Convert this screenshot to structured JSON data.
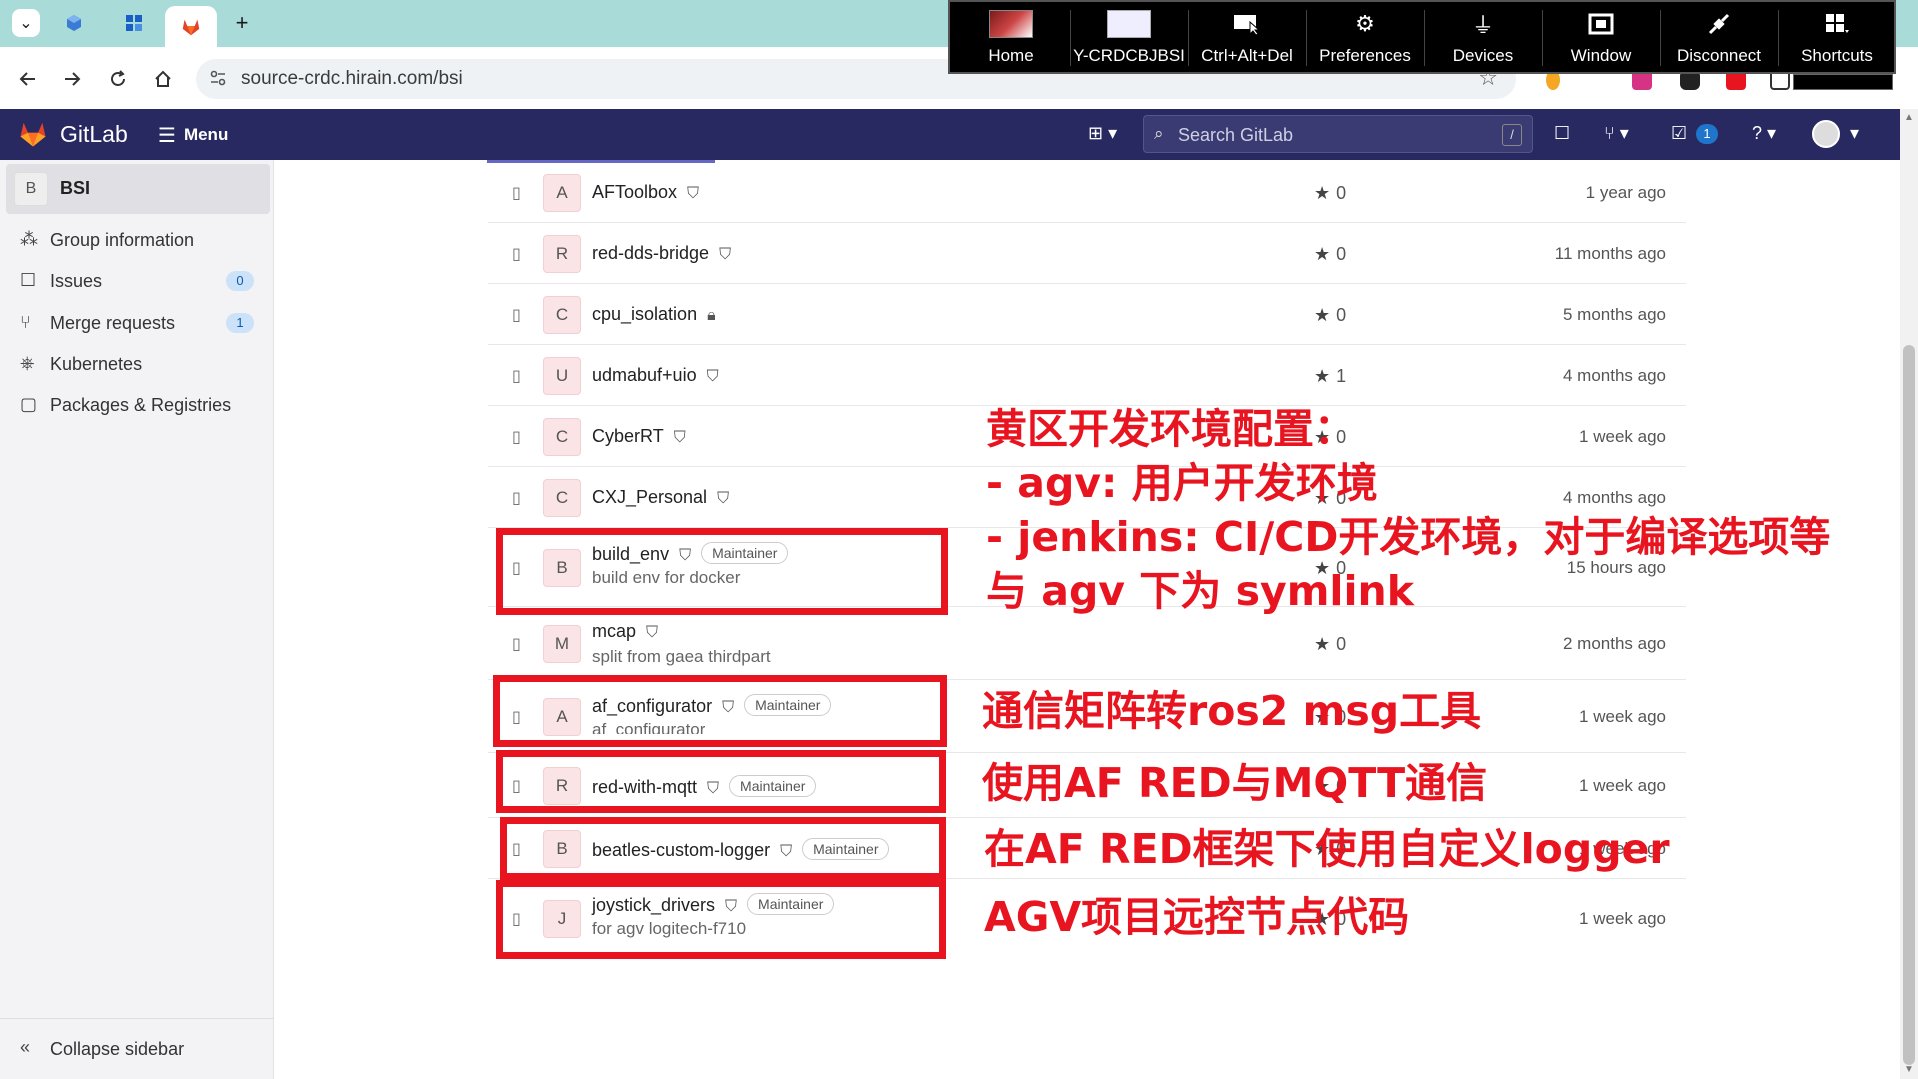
{
  "browser": {
    "url": "source-crdc.hirain.com/bsi",
    "new_tab": "+",
    "tab_menu": "⌄"
  },
  "rdp_toolbar": {
    "items": [
      {
        "label": "Home",
        "icon": "home-thumbnail-icon"
      },
      {
        "label": "Y-CRDCBJBSI",
        "icon": "machine-thumbnail-icon"
      },
      {
        "label": "Ctrl+Alt+Del",
        "icon": "ctrl-alt-del-icon"
      },
      {
        "label": "Preferences",
        "icon": "gears-icon"
      },
      {
        "label": "Devices",
        "icon": "usb-icon"
      },
      {
        "label": "Window",
        "icon": "window-icon"
      },
      {
        "label": "Disconnect",
        "icon": "plug-icon"
      },
      {
        "label": "Shortcuts",
        "icon": "grid-icon"
      }
    ]
  },
  "gitlab": {
    "title": "GitLab",
    "menu_label": "Menu",
    "search_placeholder": "Search GitLab",
    "search_shortcut": "/",
    "todo_count": "1"
  },
  "sidebar": {
    "group_avatar": "B",
    "group_name": "BSI",
    "items": [
      {
        "label": "Group information",
        "icon": "group-info-icon",
        "glyph": "⁂"
      },
      {
        "label": "Issues",
        "icon": "issues-icon",
        "glyph": "☐",
        "count": "0"
      },
      {
        "label": "Merge requests",
        "icon": "merge-request-icon",
        "glyph": "⑂",
        "count": "1"
      },
      {
        "label": "Kubernetes",
        "icon": "kubernetes-icon",
        "glyph": "⎈"
      },
      {
        "label": "Packages & Registries",
        "icon": "package-icon",
        "glyph": "▢"
      }
    ],
    "collapse_label": "Collapse sidebar"
  },
  "projects": [
    {
      "avatar": "A",
      "name": "AFToolbox",
      "visibility": "shield",
      "role": "",
      "description": "",
      "stars": "0",
      "updated": "1 year ago"
    },
    {
      "avatar": "R",
      "name": "red-dds-bridge",
      "visibility": "shield",
      "role": "",
      "description": "",
      "stars": "0",
      "updated": "11 months ago"
    },
    {
      "avatar": "C",
      "name": "cpu_isolation",
      "visibility": "lock",
      "role": "",
      "description": "",
      "stars": "0",
      "updated": "5 months ago"
    },
    {
      "avatar": "U",
      "name": "udmabuf+uio",
      "visibility": "shield",
      "role": "",
      "description": "",
      "stars": "1",
      "updated": "4 months ago"
    },
    {
      "avatar": "C",
      "name": "CyberRT",
      "visibility": "shield",
      "role": "",
      "description": "",
      "stars": "0",
      "updated": "1 week ago"
    },
    {
      "avatar": "C",
      "name": "CXJ_Personal",
      "visibility": "shield",
      "role": "",
      "description": "",
      "stars": "0",
      "updated": "4 months ago"
    },
    {
      "avatar": "B",
      "name": "build_env",
      "visibility": "shield",
      "role": "Maintainer",
      "description": "build env for docker",
      "stars": "0",
      "updated": "15 hours ago"
    },
    {
      "avatar": "M",
      "name": "mcap",
      "visibility": "shield",
      "role": "",
      "description": "split from gaea thirdpart",
      "stars": "0",
      "updated": "2 months ago"
    },
    {
      "avatar": "A",
      "name": "af_configurator",
      "visibility": "shield",
      "role": "Maintainer",
      "description": "af_configurator",
      "stars": "0",
      "updated": "1 week ago"
    },
    {
      "avatar": "R",
      "name": "red-with-mqtt",
      "visibility": "shield",
      "role": "Maintainer",
      "description": "",
      "stars": "0",
      "updated": "1 week ago"
    },
    {
      "avatar": "B",
      "name": "beatles-custom-logger",
      "visibility": "shield",
      "role": "Maintainer",
      "description": "",
      "stars": "0",
      "updated": "1 week ago"
    },
    {
      "avatar": "J",
      "name": "joystick_drivers",
      "visibility": "shield",
      "role": "Maintainer",
      "description": "for agv logitech-f710",
      "stars": "0",
      "updated": "1 week ago"
    }
  ],
  "annotations": {
    "build_env_lines": [
      "黄区开发环境配置：",
      "- agv: 用户开发环境",
      "- jenkins: CI/CD开发环境，对于编译选项等",
      "与 agv 下为 symlink"
    ],
    "af_configurator": "通信矩阵转ros2 msg工具",
    "red_with_mqtt": "使用AF RED与MQTT通信",
    "beatles_custom_logger": "在AF RED框架下使用自定义logger",
    "joystick_drivers": "AGV项目远控节点代码"
  },
  "colors": {
    "tab_strip": "#a9dcd8",
    "gitlab_nav": "#292961",
    "annotation_red": "#e8141f",
    "avatar_bg": "#fbe4e6"
  }
}
